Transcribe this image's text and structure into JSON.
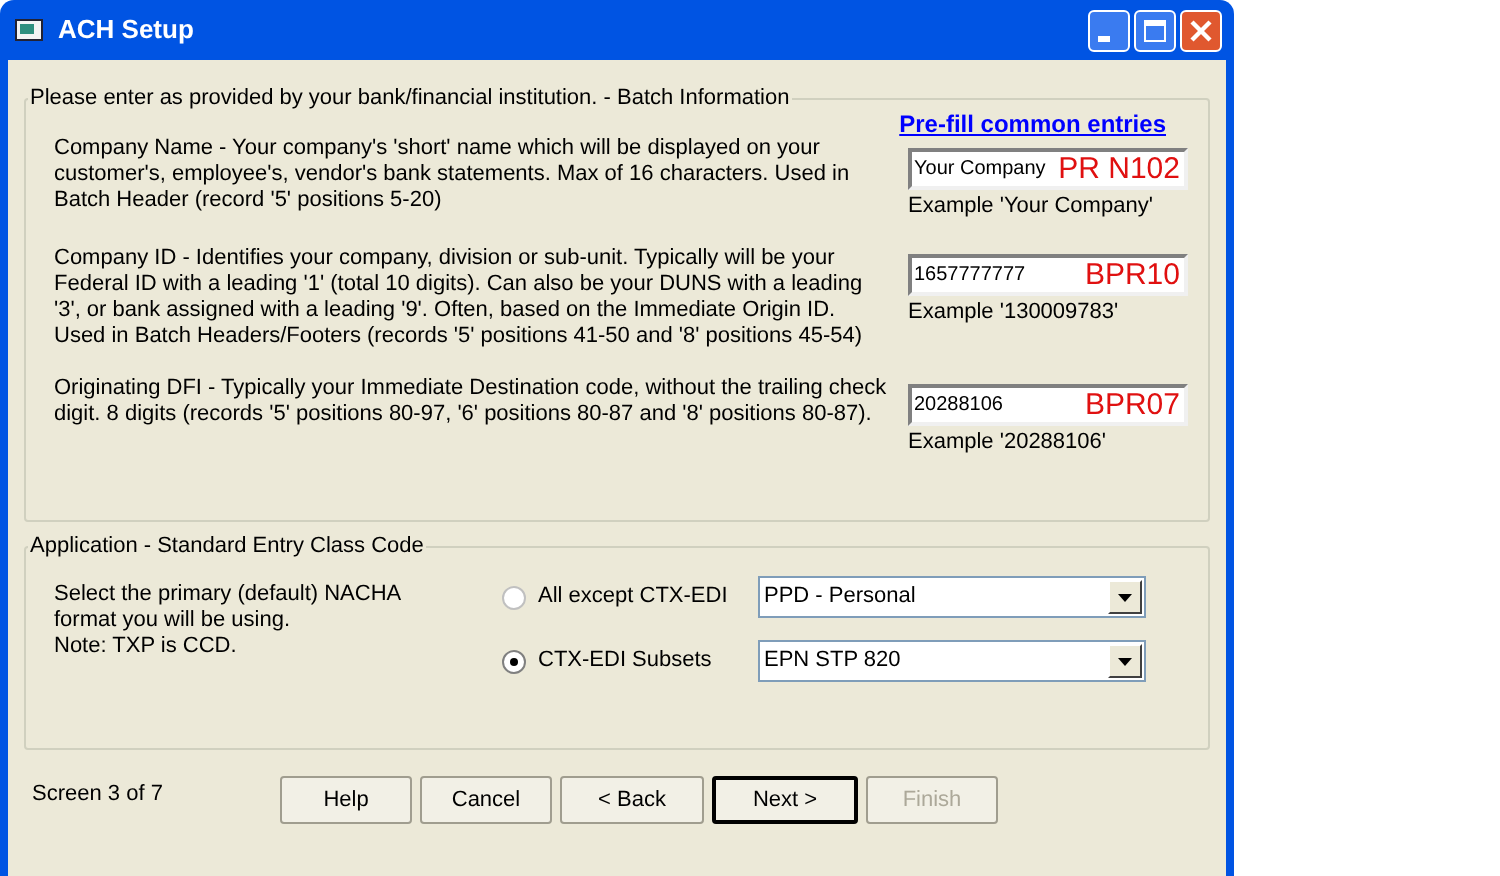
{
  "window": {
    "title": "ACH Setup"
  },
  "batch_group": {
    "legend": "Please enter as provided by your bank/financial institution. - Batch Information",
    "prefill_link": "Pre-fill common entries",
    "fields": [
      {
        "description": "Company Name - Your company's 'short' name which will be displayed on your customer's, employee's, vendor's bank statements. Max of 16 characters.  Used in Batch Header (record '5' positions 5-20)",
        "value": "Your Company",
        "tag": "PR N102",
        "example": "Example 'Your Company'"
      },
      {
        "description": "Company ID - Identifies your company, division or sub-unit.  Typically will be your Federal ID with a leading '1' (total 10 digits).   Can also be your DUNS with a leading '3', or bank assigned with a leading '9'. Often, based on the Immediate Origin ID. Used in Batch Headers/Footers (records '5' positions 41-50 and '8' positions 45-54)",
        "value": "1657777777",
        "tag": "BPR10",
        "example": "Example '130009783'"
      },
      {
        "description": "Originating DFI - Typically your Immediate Destination code, without the trailing check digit. 8 digits (records '5' positions 80-97, '6' positions 80-87 and '8' positions 80-87).",
        "value": "20288106",
        "tag": "BPR07",
        "example": "Example '20288106'"
      }
    ]
  },
  "application_group": {
    "legend": "Application - Standard Entry Class Code",
    "description": [
      "Select the primary (default) NACHA",
      "format you will be using.",
      "Note: TXP is CCD."
    ],
    "options": [
      {
        "label": "All except CTX-EDI",
        "selected": false,
        "dropdown": "PPD - Personal"
      },
      {
        "label": "CTX-EDI Subsets",
        "selected": true,
        "dropdown": "EPN STP 820"
      }
    ]
  },
  "screen_indicator": "Screen 3 of 7",
  "buttons": [
    {
      "label": "Help",
      "default": false,
      "disabled": false
    },
    {
      "label": "Cancel",
      "default": false,
      "disabled": false
    },
    {
      "label": "< Back",
      "default": false,
      "disabled": false
    },
    {
      "label": "Next >",
      "default": true,
      "disabled": false
    },
    {
      "label": "Finish",
      "default": false,
      "disabled": true
    }
  ]
}
